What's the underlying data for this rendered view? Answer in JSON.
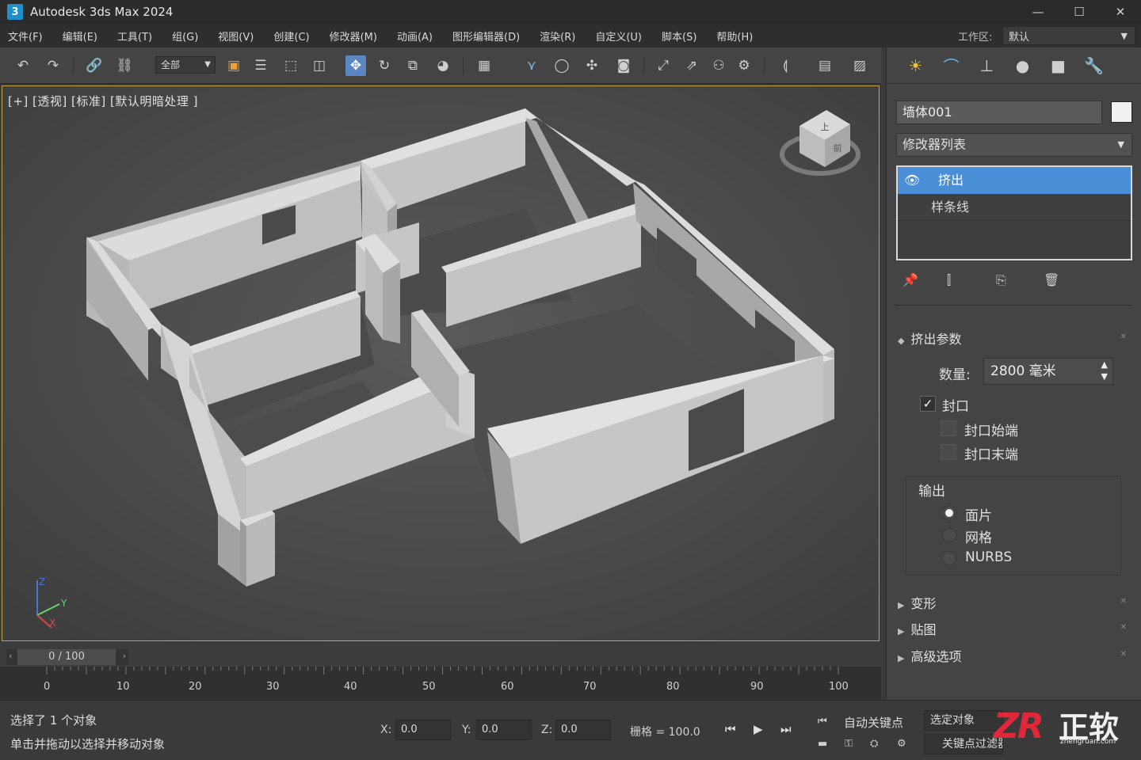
{
  "window": {
    "title": "Autodesk 3ds Max 2024",
    "app_badge": "3",
    "controls": [
      "—",
      "☐",
      "✕"
    ]
  },
  "menu": [
    "文件(F)",
    "编辑(E)",
    "工具(T)",
    "组(G)",
    "视图(V)",
    "创建(C)",
    "修改器(M)",
    "动画(A)",
    "图形编辑器(D)",
    "渲染(R)",
    "自定义(U)",
    "脚本(S)",
    "帮助(H)"
  ],
  "workspace": {
    "label": "工作区:",
    "value": "默认"
  },
  "toolbar": {
    "selection_filter": "全部"
  },
  "viewport": {
    "label": "[+] [透视] [标准] [默认明暗处理 ]",
    "viewcube_top": "上",
    "viewcube_front": "前",
    "axes": [
      "Z",
      "Y",
      "X"
    ],
    "border_color": "#c9a14a"
  },
  "command_panel": {
    "object_name": "墙体001",
    "object_color": "#f1f1f1",
    "modifier_list": "修改器列表",
    "stack": [
      "挤出",
      "样条线"
    ],
    "rollout_params": "挤出参数",
    "amount_label": "数量:",
    "amount_value": "2800 毫米",
    "cap_label": "封口",
    "cap_start_label": "封口始端",
    "cap_end_label": "封口末端",
    "cap_checked": true,
    "cap_start_checked": false,
    "cap_end_checked": false,
    "output_label": "输出",
    "output_options": [
      "面片",
      "网格",
      "NURBS"
    ],
    "output_selected": "面片",
    "rollouts": [
      "变形",
      "贴图",
      "高级选项"
    ]
  },
  "timeline": {
    "frame": "0 / 100",
    "ticks": [
      "0",
      "10",
      "20",
      "30",
      "40",
      "50",
      "60",
      "70",
      "80",
      "90",
      "100"
    ]
  },
  "status": {
    "line1": "选择了 1 个对象",
    "line2": "单击并拖动以选择并移动对象",
    "x_label": "X:",
    "x_value": "0.0",
    "y_label": "Y:",
    "y_value": "0.0",
    "z_label": "Z:",
    "z_value": "0.0",
    "grid": "栅格 = 100.0",
    "autokey": "自动关键点",
    "selected_object": "选定对象",
    "key_filters": "关键点过滤器..."
  },
  "watermark": {
    "zr": "ZR",
    "cn": "正软",
    "url": "zhengruan.com"
  }
}
